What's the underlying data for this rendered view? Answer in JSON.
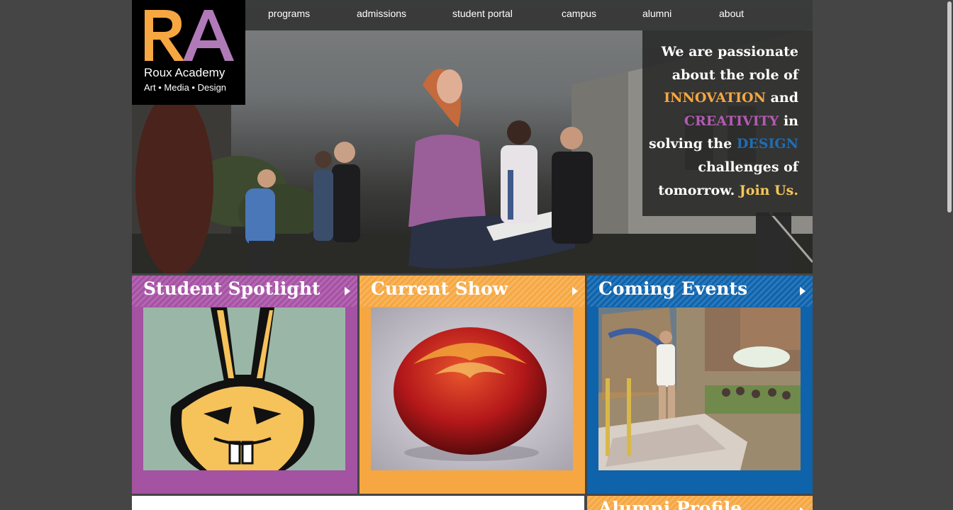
{
  "logo": {
    "letters": "RA",
    "name": "Roux Academy",
    "tagline": "Art • Media • Design"
  },
  "nav": {
    "items": [
      "programs",
      "admissions",
      "student portal",
      "campus",
      "alumni",
      "about"
    ]
  },
  "hero": {
    "line1": "We are passionate",
    "line2": "about the role of",
    "innovation": "INNOVATION",
    "and": " and",
    "creativity": "CREATIVITY",
    "in": " in",
    "solving": "solving the ",
    "design": "DESIGN",
    "challenges": "challenges of",
    "tomorrow": "tomorrow. ",
    "join": "Join Us."
  },
  "panels": [
    {
      "title": "Student Spotlight",
      "color": "#a452a2"
    },
    {
      "title": "Current Show",
      "color": "#f6a742"
    },
    {
      "title": "Coming Events",
      "color": "#0f63aa"
    }
  ],
  "alumni": {
    "title": "Alumni Profile"
  },
  "colors": {
    "orange": "#f6a742",
    "purple": "#b35ab3",
    "blue": "#1f6db2",
    "yellow": "#f7c65a",
    "background": "#454545"
  }
}
